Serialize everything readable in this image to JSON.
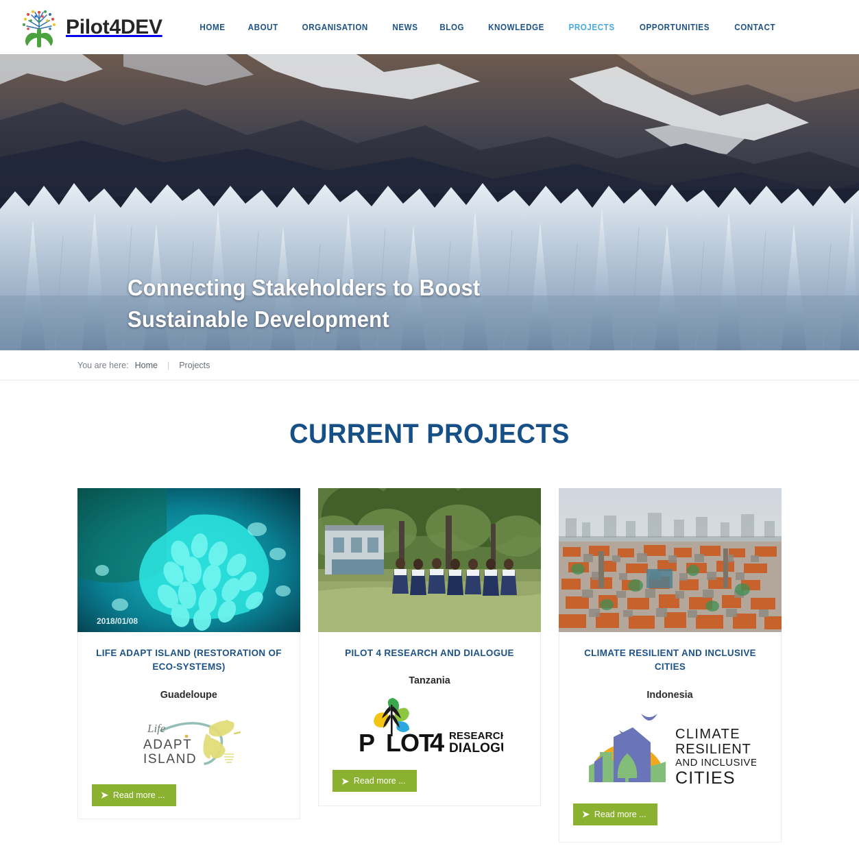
{
  "header": {
    "brand_name": "Pilot4DEV",
    "logo_icon": "tree-people-logo",
    "nav": [
      {
        "label": "HOME",
        "active": false
      },
      {
        "label": "ABOUT",
        "active": false
      },
      {
        "label": "ORGANISATION",
        "active": false
      },
      {
        "label": "NEWS",
        "active": false
      },
      {
        "label": "BLOG",
        "active": false
      },
      {
        "label": "KNOWLEDGE",
        "active": false
      },
      {
        "label": "PROJECTS",
        "active": true
      },
      {
        "label": "OPPORTUNITIES",
        "active": false
      },
      {
        "label": "CONTACT",
        "active": false
      }
    ]
  },
  "hero": {
    "headline_line1": "Connecting Stakeholders to Boost",
    "headline_line2": "Sustainable Development",
    "image_description": "glacier-mountain-banner"
  },
  "breadcrumb": {
    "label": "You are here:",
    "home": "Home",
    "separator": "|",
    "current": "Projects"
  },
  "main": {
    "title": "CURRENT PROJECTS",
    "cards": [
      {
        "title": "LIFE ADAPT ISLAND (RESTORATION OF ECO-SYSTEMS)",
        "country": "Guadeloupe",
        "image": "coral-reef-photo",
        "image_timestamp": "2018/01/08",
        "logo": "life-adapt-island-logo",
        "logo_text_script": "Life",
        "logo_text_1": "ADAPT",
        "logo_text_2": "ISLAND",
        "button": "Read more ..."
      },
      {
        "title": "PILOT 4 RESEARCH AND DIALOGUE",
        "country": "Tanzania",
        "image": "school-children-tanzania-photo",
        "logo": "pilot4-research-dialogue-logo",
        "logo_text_1": "P",
        "logo_text_2": "LOT",
        "logo_text_3": "4",
        "logo_text_4": "RESEARCH AND",
        "logo_text_5": "DIALOGUE",
        "button": "Read more ..."
      },
      {
        "title": "CLIMATE RESILIENT AND INCLUSIVE CITIES",
        "country": "Indonesia",
        "image": "jakarta-cityscape-photo",
        "logo": "climate-resilient-cities-logo",
        "logo_text_1": "CLIMATE",
        "logo_text_2": "RESILIENT",
        "logo_text_3": "AND INCLUSIVE",
        "logo_text_4": "CITIES",
        "button": "Read more ..."
      }
    ]
  },
  "colors": {
    "nav_link": "#1c5288",
    "nav_active": "#4aa8d8",
    "title_blue": "#175087",
    "button_green": "#8ab230",
    "text_dark": "#2b2b2b"
  }
}
